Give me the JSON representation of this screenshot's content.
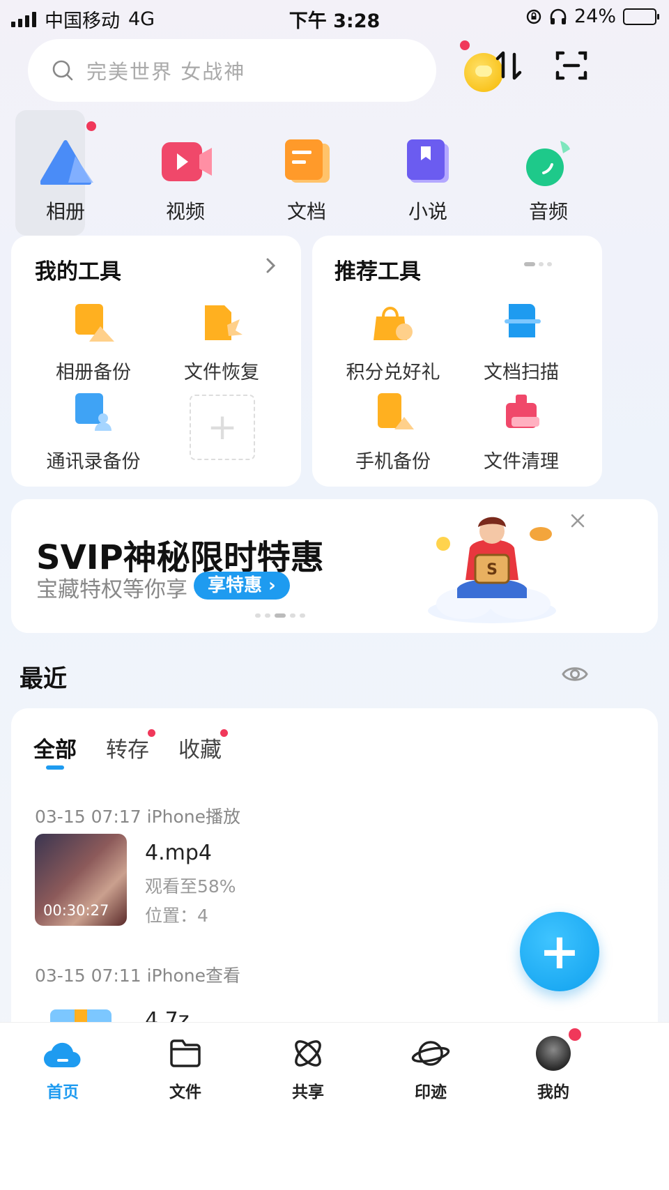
{
  "status_bar": {
    "carrier": "中国移动",
    "network": "4G",
    "time": "下午 3:28",
    "battery": "24%",
    "battery_level": 0.24
  },
  "search": {
    "placeholder": "完美世界 女战神"
  },
  "categories": [
    {
      "label": "相册",
      "icon": "album-icon",
      "color": "#4a8cf7"
    },
    {
      "label": "视频",
      "icon": "video-icon",
      "color": "#f0486a"
    },
    {
      "label": "文档",
      "icon": "document-icon",
      "color": "#ff9a2a"
    },
    {
      "label": "小说",
      "icon": "novel-icon",
      "color": "#6b5cf0"
    },
    {
      "label": "音频",
      "icon": "audio-icon",
      "color": "#1ec98a"
    }
  ],
  "my_tools": {
    "title": "我的工具",
    "items": [
      {
        "label": "相册备份",
        "icon": "album-backup-icon"
      },
      {
        "label": "文件恢复",
        "icon": "file-recovery-icon"
      },
      {
        "label": "通讯录备份",
        "icon": "contacts-backup-icon"
      }
    ]
  },
  "recommended_tools": {
    "title": "推荐工具",
    "items": [
      {
        "label": "积分兑好礼",
        "icon": "points-gift-icon"
      },
      {
        "label": "文档扫描",
        "icon": "document-scan-icon"
      },
      {
        "label": "手机备份",
        "icon": "phone-backup-icon"
      },
      {
        "label": "文件清理",
        "icon": "file-cleanup-icon"
      }
    ]
  },
  "banner": {
    "title": "SVIP神秘限时特惠",
    "subtitle": "宝藏特权等你享",
    "cta": "享特惠 ›"
  },
  "recent": {
    "title": "最近",
    "tabs": [
      {
        "label": "全部",
        "active": true
      },
      {
        "label": "转存",
        "badge": true
      },
      {
        "label": "收藏",
        "badge": true
      }
    ],
    "entries": [
      {
        "meta": "03-15 07:17 iPhone播放",
        "name": "4.mp4",
        "progress": "观看至58%",
        "position": "位置：4",
        "duration": "00:30:27"
      },
      {
        "meta": "03-15 07:11 iPhone查看",
        "name": "4.7z"
      }
    ]
  },
  "bottom_nav": [
    {
      "label": "首页",
      "active": true
    },
    {
      "label": "文件"
    },
    {
      "label": "共享"
    },
    {
      "label": "印迹"
    },
    {
      "label": "我的"
    }
  ],
  "accent": "#1e9bf0"
}
